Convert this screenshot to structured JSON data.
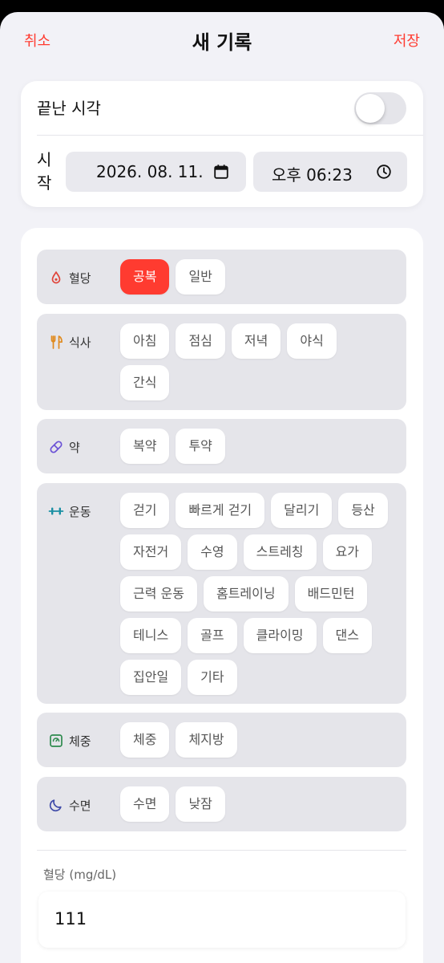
{
  "header": {
    "cancel_label": "취소",
    "title": "새 기록",
    "save_label": "저장"
  },
  "time_card": {
    "end_time_label": "끝난 시각",
    "end_time_enabled": false,
    "start_label": "시작",
    "date_value": "2026. 08. 11.",
    "time_value": "오후 06:23"
  },
  "categories": [
    {
      "label": "혈당",
      "icon": "blood-drop-icon",
      "icon_color": "#e0463c",
      "chips": [
        {
          "label": "공복",
          "selected": true
        },
        {
          "label": "일반",
          "selected": false
        }
      ]
    },
    {
      "label": "식사",
      "icon": "utensils-icon",
      "icon_color": "#e08a1e",
      "chips": [
        {
          "label": "아침"
        },
        {
          "label": "점심"
        },
        {
          "label": "저녁"
        },
        {
          "label": "야식"
        },
        {
          "label": "간식"
        }
      ]
    },
    {
      "label": "약",
      "icon": "pill-icon",
      "icon_color": "#6b52d6",
      "chips": [
        {
          "label": "복약"
        },
        {
          "label": "투약"
        }
      ]
    },
    {
      "label": "운동",
      "icon": "dumbbell-icon",
      "icon_color": "#1a8fa3",
      "chips": [
        {
          "label": "걷기"
        },
        {
          "label": "빠르게 걷기"
        },
        {
          "label": "달리기"
        },
        {
          "label": "등산"
        },
        {
          "label": "자전거"
        },
        {
          "label": "수영"
        },
        {
          "label": "스트레칭"
        },
        {
          "label": "요가"
        },
        {
          "label": "근력 운동"
        },
        {
          "label": "홈트레이닝"
        },
        {
          "label": "배드민턴"
        },
        {
          "label": "테니스"
        },
        {
          "label": "골프"
        },
        {
          "label": "클라이밍"
        },
        {
          "label": "댄스"
        },
        {
          "label": "집안일"
        },
        {
          "label": "기타"
        }
      ]
    },
    {
      "label": "체중",
      "icon": "scale-icon",
      "icon_color": "#2e8a4e",
      "chips": [
        {
          "label": "체중"
        },
        {
          "label": "체지방"
        }
      ]
    },
    {
      "label": "수면",
      "icon": "moon-icon",
      "icon_color": "#3e4aa8",
      "chips": [
        {
          "label": "수면"
        },
        {
          "label": "낮잠"
        }
      ]
    }
  ],
  "field": {
    "label": "혈당 (mg/dL)",
    "value": "111"
  },
  "colors": {
    "accent": "#ff3b30",
    "background": "#f2f2f7",
    "chip_group_bg": "#e5e5ea"
  }
}
